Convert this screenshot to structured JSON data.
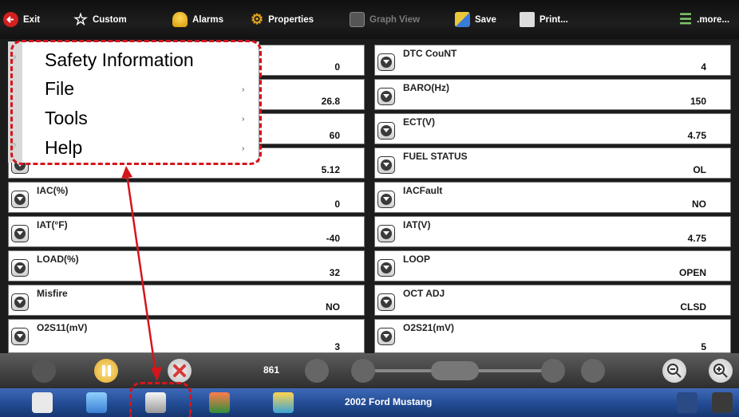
{
  "toolbar": {
    "exit": "Exit",
    "custom": "Custom",
    "alarms": "Alarms",
    "properties": "Properties",
    "graph_view": "Graph View",
    "save": "Save",
    "print": "Print...",
    "more": ".more..."
  },
  "menu": {
    "items": [
      "Safety Information",
      "File",
      "Tools",
      "Help"
    ],
    "submenu_marker": "›",
    "help_marker": "?"
  },
  "left_values": [
    "0",
    "26.8",
    "60",
    "5.12"
  ],
  "left_rows": [
    {
      "label": "IAC(%)",
      "value": "0"
    },
    {
      "label": "IAT(°F)",
      "value": "-40"
    },
    {
      "label": "LOAD(%)",
      "value": "32"
    },
    {
      "label": "Misfire",
      "value": "NO"
    },
    {
      "label": "O2S11(mV)",
      "value": "3"
    }
  ],
  "right_rows": [
    {
      "label": "DTC CouNT",
      "value": "4"
    },
    {
      "label": "BARO(Hz)",
      "value": "150"
    },
    {
      "label": "ECT(V)",
      "value": "4.75"
    },
    {
      "label": "FUEL STATUS",
      "value": "OL"
    },
    {
      "label": "IACFault",
      "value": "NO"
    },
    {
      "label": "IAT(V)",
      "value": "4.75"
    },
    {
      "label": "LOOP",
      "value": "OPEN"
    },
    {
      "label": "OCT ADJ",
      "value": "CLSD"
    },
    {
      "label": "O2S21(mV)",
      "value": "5"
    }
  ],
  "controls": {
    "frame_count": "861"
  },
  "taskbar": {
    "vehicle": "2002 Ford Mustang"
  },
  "colors": {
    "annotation_red": "#d6151b",
    "toolbar_bg": "#111111",
    "taskbar_bg": "#224b93",
    "pause_yellow": "#f0c24a",
    "stop_red": "#d83a3a"
  }
}
